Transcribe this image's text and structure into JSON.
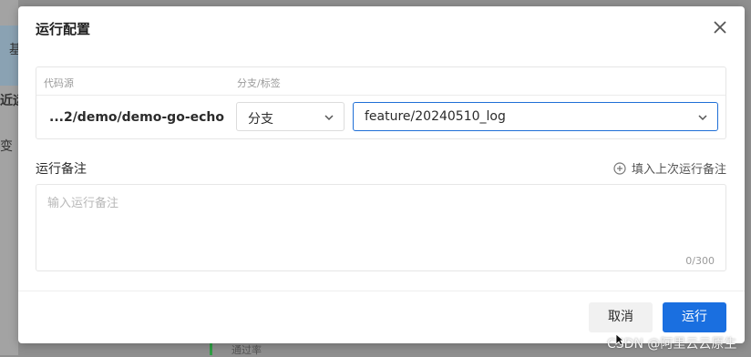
{
  "background": {
    "tile1_text": "基",
    "tile2_text": "近运",
    "tile3_text": "变",
    "bottom_text": "通过率"
  },
  "dialog": {
    "title": "运行配置",
    "close_icon": "close-icon",
    "config": {
      "header_source": "代码源",
      "header_branch": "分支/标签",
      "repo_path": "...2/demo/demo-go-echo",
      "ref_type": "分支",
      "branch_value": "feature/20240510_log"
    },
    "note": {
      "label": "运行备注",
      "fill_last_label": "填入上次运行备注",
      "placeholder": "输入运行备注",
      "counter": "0/300"
    },
    "buttons": {
      "cancel": "取消",
      "run": "运行"
    }
  },
  "watermark": "CSDN @阿里云云原生",
  "colors": {
    "primary": "#1a6fe0",
    "overlay": "#8f8f8f"
  }
}
